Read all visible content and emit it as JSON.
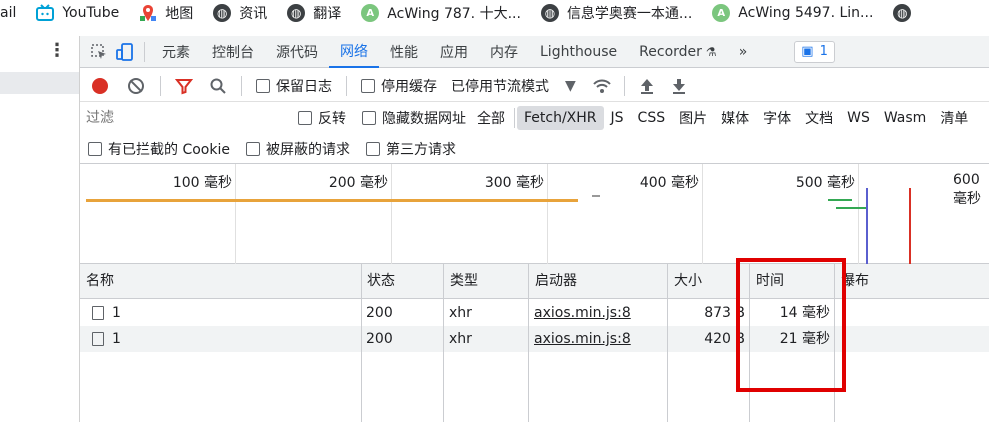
{
  "bookmarks": [
    {
      "label": "ail",
      "icon": "none"
    },
    {
      "label": "YouTube",
      "icon": "tv-icon"
    },
    {
      "label": "地图",
      "icon": "maps-icon"
    },
    {
      "label": "资讯",
      "icon": "globe-icon"
    },
    {
      "label": "翻译",
      "icon": "globe-icon"
    },
    {
      "label": "AcWing 787. 十大...",
      "icon": "acwing-icon"
    },
    {
      "label": "信息学奥赛一本通...",
      "icon": "globe-icon"
    },
    {
      "label": "AcWing 5497. Lin...",
      "icon": "acwing-icon"
    }
  ],
  "tabs": [
    "元素",
    "控制台",
    "源代码",
    "网络",
    "性能",
    "应用",
    "内存",
    "Lighthouse",
    "Recorder"
  ],
  "active_tab": "网络",
  "issues_count": "1",
  "toolbar": {
    "preserve_log": "保留日志",
    "disable_cache": "停用缓存",
    "throttle": "已停用节流模式"
  },
  "filter": {
    "placeholder": "过滤",
    "invert": "反转",
    "hide_data_urls": "隐藏数据网址",
    "types": [
      "全部",
      "Fetch/XHR",
      "JS",
      "CSS",
      "图片",
      "媒体",
      "字体",
      "文档",
      "WS",
      "Wasm",
      "清单"
    ],
    "active_type": "Fetch/XHR",
    "blocked_cookies": "有已拦截的 Cookie",
    "blocked_requests": "被屏蔽的请求",
    "third_party": "第三方请求"
  },
  "timeline": {
    "ticks": [
      "100 毫秒",
      "200 毫秒",
      "300 毫秒",
      "400 毫秒",
      "500 毫秒",
      "600 毫秒"
    ]
  },
  "table": {
    "headers": [
      "名称",
      "状态",
      "类型",
      "启动器",
      "大小",
      "时间",
      "瀑布"
    ],
    "rows": [
      {
        "name": "1",
        "status": "200",
        "type": "xhr",
        "initiator": "axios.min.js:8",
        "size": "873 B",
        "time": "14 毫秒"
      },
      {
        "name": "1",
        "status": "200",
        "type": "xhr",
        "initiator": "axios.min.js:8",
        "size": "420 B",
        "time": "21 毫秒"
      }
    ]
  },
  "colors": {
    "accent": "#1a73e8",
    "record": "#d93025",
    "highlight_box": "#e00000"
  }
}
